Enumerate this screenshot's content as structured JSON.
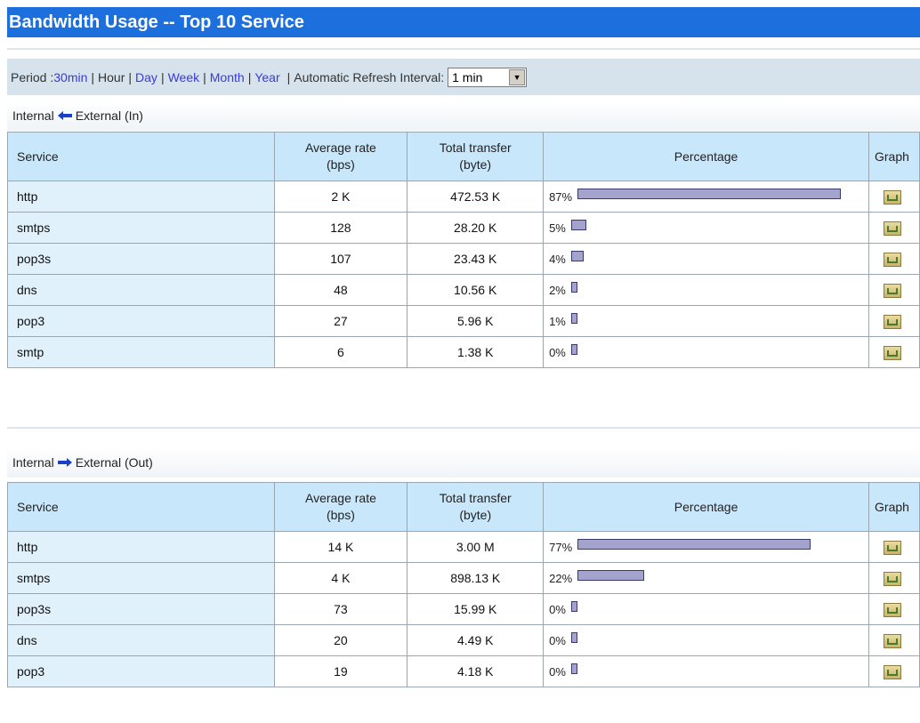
{
  "title": "Bandwidth Usage -- Top 10 Service",
  "period": {
    "label": "Period : ",
    "options": [
      {
        "label": "30min",
        "link": true
      },
      {
        "label": "Hour",
        "link": false
      },
      {
        "label": "Day",
        "link": true
      },
      {
        "label": "Week",
        "link": true
      },
      {
        "label": "Month",
        "link": true
      },
      {
        "label": "Year",
        "link": true
      }
    ],
    "refresh_label": "Automatic Refresh Interval:",
    "refresh_value": "1 min"
  },
  "headers": {
    "service": "Service",
    "avg_rate_1": "Average rate",
    "avg_rate_2": "(bps)",
    "total_1": "Total transfer",
    "total_2": "(byte)",
    "percentage": "Percentage",
    "graph": "Graph"
  },
  "inbound": {
    "left": "Internal",
    "right": "External (In)",
    "rows": [
      {
        "service": "http",
        "rate": "2 K",
        "total": "472.53 K",
        "percentage": "87%",
        "pct": 87
      },
      {
        "service": "smtps",
        "rate": "128",
        "total": "28.20 K",
        "percentage": "5%",
        "pct": 5
      },
      {
        "service": "pop3s",
        "rate": "107",
        "total": "23.43 K",
        "percentage": "4%",
        "pct": 4
      },
      {
        "service": "dns",
        "rate": "48",
        "total": "10.56 K",
        "percentage": "2%",
        "pct": 2
      },
      {
        "service": "pop3",
        "rate": "27",
        "total": "5.96 K",
        "percentage": "1%",
        "pct": 1
      },
      {
        "service": "smtp",
        "rate": "6",
        "total": "1.38 K",
        "percentage": "0%",
        "pct": 0
      }
    ]
  },
  "outbound": {
    "left": "Internal",
    "right": "External (Out)",
    "rows": [
      {
        "service": "http",
        "rate": "14 K",
        "total": "3.00 M",
        "percentage": "77%",
        "pct": 77
      },
      {
        "service": "smtps",
        "rate": "4 K",
        "total": "898.13 K",
        "percentage": "22%",
        "pct": 22
      },
      {
        "service": "pop3s",
        "rate": "73",
        "total": "15.99 K",
        "percentage": "0%",
        "pct": 0
      },
      {
        "service": "dns",
        "rate": "20",
        "total": "4.49 K",
        "percentage": "0%",
        "pct": 0
      },
      {
        "service": "pop3",
        "rate": "19",
        "total": "4.18 K",
        "percentage": "0%",
        "pct": 0
      }
    ]
  },
  "colors": {
    "title_bar": "#1e6fde",
    "header_bg": "#c9e7fb",
    "service_bg": "#e1f1fc",
    "bar_fill": "#a3a3cd",
    "link": "#3a3ad8",
    "arrow": "#1a3fc8"
  },
  "icons": {
    "graph": "chart-thumbnail-icon",
    "in_arrow": "arrow-left-icon",
    "out_arrow": "arrow-right-icon",
    "dropdown": "chevron-down-icon"
  }
}
